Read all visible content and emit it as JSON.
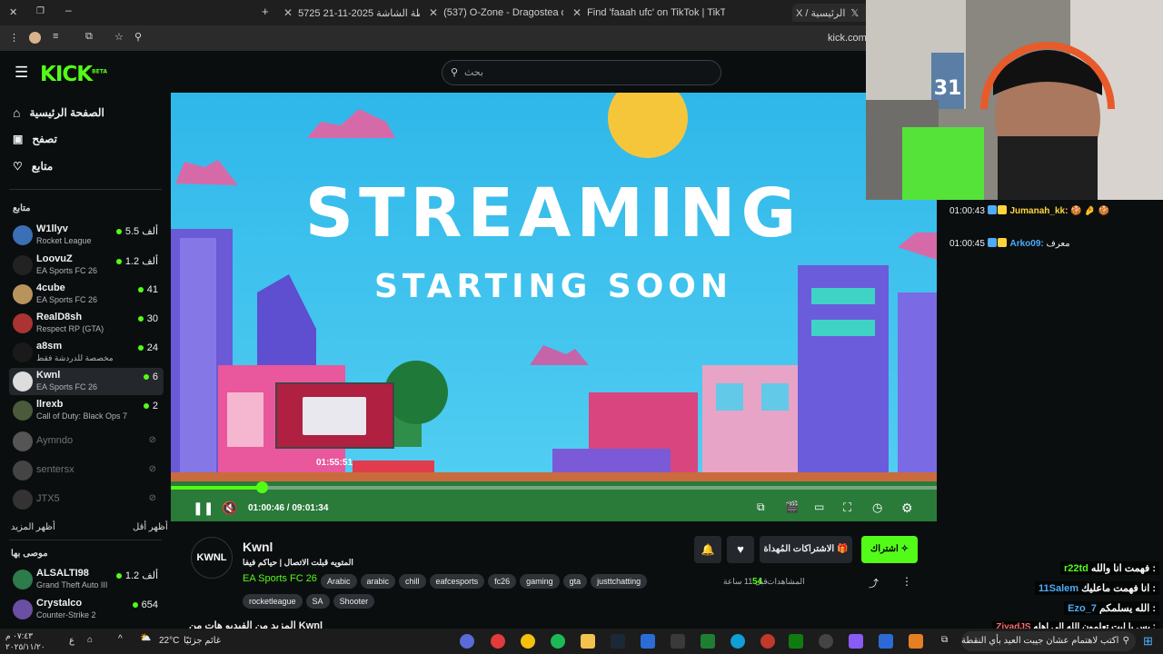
{
  "browser": {
    "tabs": [
      {
        "label": "لقطة الشاشة 2025-11-21 5725"
      },
      {
        "label": "(537) O-Zone - Dragostea d"
      },
      {
        "label": "Find 'faaah ufc' on TikTok | TikT"
      },
      {
        "label": "X / الرئيسية"
      }
    ],
    "new_tab": "+",
    "url": "kick.com/"
  },
  "header": {
    "logo": "KICK",
    "logo_beta": "BETA",
    "search_placeholder": "بحث"
  },
  "sidebar": {
    "nav": [
      {
        "label": "الصفحة الرئيسية",
        "icon": "home-icon"
      },
      {
        "label": "تصفح",
        "icon": "browse-icon"
      },
      {
        "label": "متابع",
        "icon": "heart-icon"
      }
    ],
    "following_heading": "متابع",
    "following": [
      {
        "name": "W1llyv",
        "category": "Rocket League",
        "viewers": "5.5 ألف",
        "live": true
      },
      {
        "name": "LoovuZ",
        "category": "EA Sports FC 26",
        "viewers": "1.2 ألف",
        "live": true
      },
      {
        "name": "4cube",
        "category": "EA Sports FC 26",
        "viewers": "41",
        "live": true
      },
      {
        "name": "RealD8sh",
        "category": "Respect RP (GTA)",
        "viewers": "30",
        "live": true
      },
      {
        "name": "a8sm",
        "category": "مخصصة للدردشة فقط",
        "viewers": "24",
        "live": true
      },
      {
        "name": "Kwnl",
        "category": "EA Sports FC 26",
        "viewers": "6",
        "live": true,
        "active": true
      },
      {
        "name": "llrexb",
        "category": "Call of Duty: Black Ops 7",
        "viewers": "2",
        "live": true
      },
      {
        "name": "Aymndo",
        "live": false
      },
      {
        "name": "sentersx",
        "live": false
      },
      {
        "name": "JTX5",
        "live": false
      }
    ],
    "show_more": "أظهر المزيد",
    "show_less": "أظهر أقل",
    "recommended_heading": "موصى بها",
    "recommended": [
      {
        "name": "ALSALTI98",
        "category": "Grand Theft Auto III",
        "viewers": "1.2 ألف"
      },
      {
        "name": "Crystalco",
        "category": "Counter-Strike 2",
        "viewers": "654"
      }
    ]
  },
  "player": {
    "title_line1": "STREAMING",
    "title_line2": "STARTING SOON",
    "preview_time": "01:55:51",
    "time": "01:00:46 / 09:01:34",
    "progress": 0.119
  },
  "stream": {
    "channel": "Kwnl",
    "avatar_text": "KWNL",
    "title": "المتويه قبلت الاتصال | حياكم فيفا",
    "category": "EA Sports FC 26",
    "tags": [
      "Arabic",
      "arabic",
      "chill",
      "eafcesports",
      "fc26",
      "gaming",
      "gta",
      "justtchatting",
      "rocketleague",
      "SA",
      "Shooter"
    ],
    "subscribe": "اشتراك",
    "gift": "الاشتراكات المُهداة",
    "viewers_count": "54",
    "viewers_label": "المشاهدات",
    "ago": "قبل 11 ساعة",
    "more_videos": "المزيد من الفيديو هات من Kwnl"
  },
  "chat": {
    "messages": [
      {
        "time": "01:00:43",
        "user": "Jumanah_kk:",
        "text": "🍪 🤌 🍪",
        "color": "#ffd43b"
      },
      {
        "time": "01:00:45",
        "user": "Arko09:",
        "text": "معرف",
        "color": "#4dabf7"
      }
    ],
    "overlay": [
      {
        "user": "r22td",
        "text": "فهمت انا والله :",
        "color": "#53fc18"
      },
      {
        "user": "11Salem",
        "text": "انا فهمت ماعليك :",
        "color": "#4dabf7"
      },
      {
        "user": "Ezo_7",
        "text": "الله يسلمكم :",
        "color": "#4dabf7"
      },
      {
        "user": "ZiyadJS",
        "text": "بس يا ليت تعلمون الله الى اهله :",
        "color": "#ff6b6b"
      }
    ],
    "input_placeholder": "اكتب لاهتمام عشان جيبت العيد بأي النقطة"
  },
  "taskbar": {
    "weather_temp": "22°C",
    "weather_text": "غائم جزئيًا",
    "time": "٠٧:٤٣ م",
    "date": "٢٠٢٥/١١/٢٠",
    "lang": "ع"
  }
}
